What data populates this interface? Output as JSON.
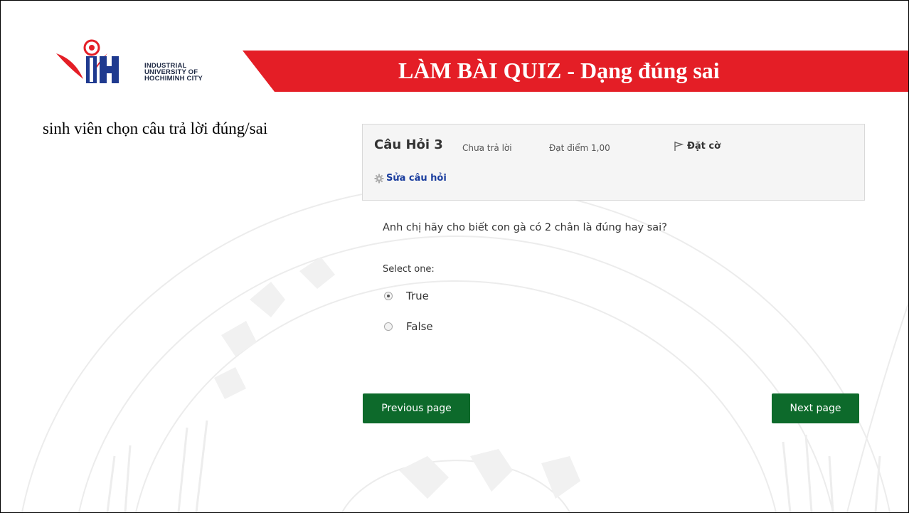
{
  "logo": {
    "line1": "INDUSTRIAL",
    "line2": "UNIVERSITY OF",
    "line3": "HOCHIMINH CITY"
  },
  "banner": {
    "title": "LÀM BÀI QUIZ - Dạng đúng sai",
    "color": "#e41e26"
  },
  "intro_text": "sinh viên chọn câu trả lời đúng/sai",
  "question": {
    "title": "Câu Hỏi 3",
    "status": "Chưa trả lời",
    "grade": "Đạt điểm 1,00",
    "flag_label": "Đặt cờ",
    "edit_label": "Sửa câu hỏi",
    "text": "Anh chị hãy cho biết con gà có 2 chân là đúng hay sai?",
    "select_label": "Select one:",
    "options": [
      {
        "label": "True",
        "selected": true
      },
      {
        "label": "False",
        "selected": false
      }
    ]
  },
  "navigation": {
    "previous_label": "Previous page",
    "next_label": "Next page",
    "button_color": "#0d6a2b"
  }
}
